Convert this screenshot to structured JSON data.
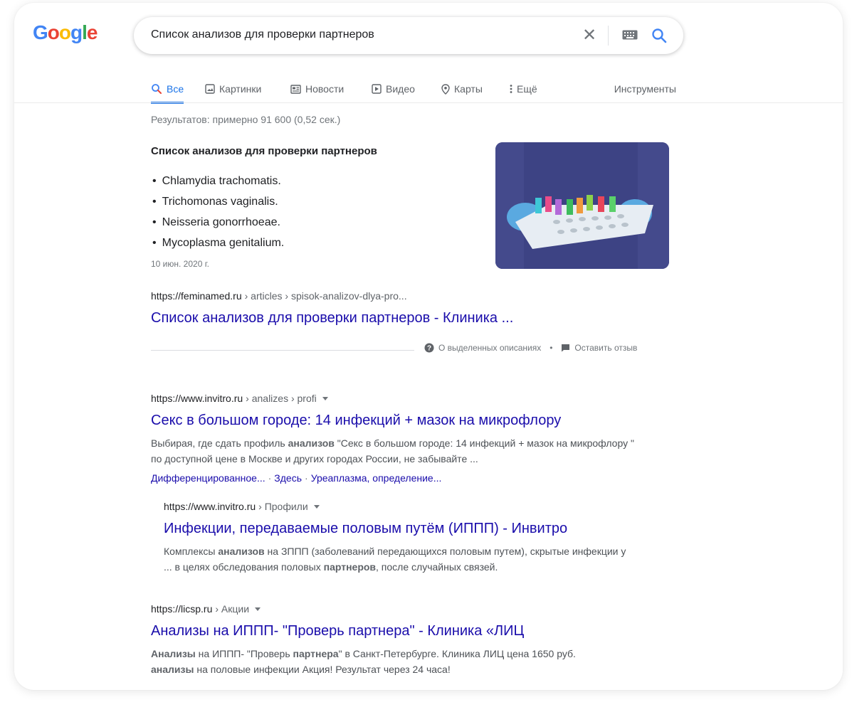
{
  "search": {
    "query": "Список анализов для проверки партнеров"
  },
  "tabs": {
    "all": "Все",
    "images": "Картинки",
    "news": "Новости",
    "video": "Видео",
    "maps": "Карты",
    "more": "Ещё",
    "tools": "Инструменты"
  },
  "stats": "Результатов: примерно 91 600 (0,52 сек.)",
  "snippet": {
    "title": "Список анализов для проверки партнеров",
    "items": [
      "Chlamydia trachomatis.",
      "Trichomonas vaginalis.",
      "Neisseria gonorrhoeae.",
      "Mycoplasma genitalium."
    ],
    "date": "10 июн. 2020 г.",
    "cite_domain": "https://feminamed.ru",
    "cite_path": "› articles › spisok-analizov-dlya-pro...",
    "link_title": "Список анализов для проверки партнеров - Клиника ...",
    "about": "О выделенных описаниях",
    "feedback": "Оставить отзыв"
  },
  "results": [
    {
      "cite_domain": "https://www.invitro.ru",
      "cite_path": "› analizes › profi",
      "title": "Секс в большом городе: 14 инфекций + мазок на микрофлору",
      "desc_parts": [
        "Выбирая, где сдать профиль ",
        "анализов",
        " \"Секс в большом городе: 14 инфекций + мазок на микрофлору \" по доступной цене в Москве и других городах России, не забывайте ..."
      ],
      "sitelinks": [
        "Дифференцированное...",
        "Здесь",
        "Уреаплазма, определение..."
      ]
    },
    {
      "cite_domain": "https://www.invitro.ru",
      "cite_path": "› Профили",
      "title": "Инфекции, передаваемые половым путём (ИППП) - Инвитро",
      "desc_parts": [
        "Комплексы ",
        "анализов",
        " на ЗППП (заболеваний передающихся половым путем), скрытые инфекции у ... в целях обследования половых ",
        "партнеров",
        ", после случайных связей."
      ]
    },
    {
      "cite_domain": "https://licsp.ru",
      "cite_path": "› Акции",
      "title": "Анализы на ИППП- \"Проверь партнера\" - Клиника «ЛИЦ",
      "desc_parts": [
        "Анализы",
        " на ИППП- \"Проверь ",
        "партнера",
        "\" в Санкт-Петербурге. Клиника ЛИЦ цена 1650 руб. ",
        "анализы",
        " на половые инфекции Акция! Результат через 24 часа!"
      ]
    }
  ],
  "colors": {
    "link": "#1a0dab",
    "accent": "#1a73e8",
    "muted": "#70757a"
  }
}
